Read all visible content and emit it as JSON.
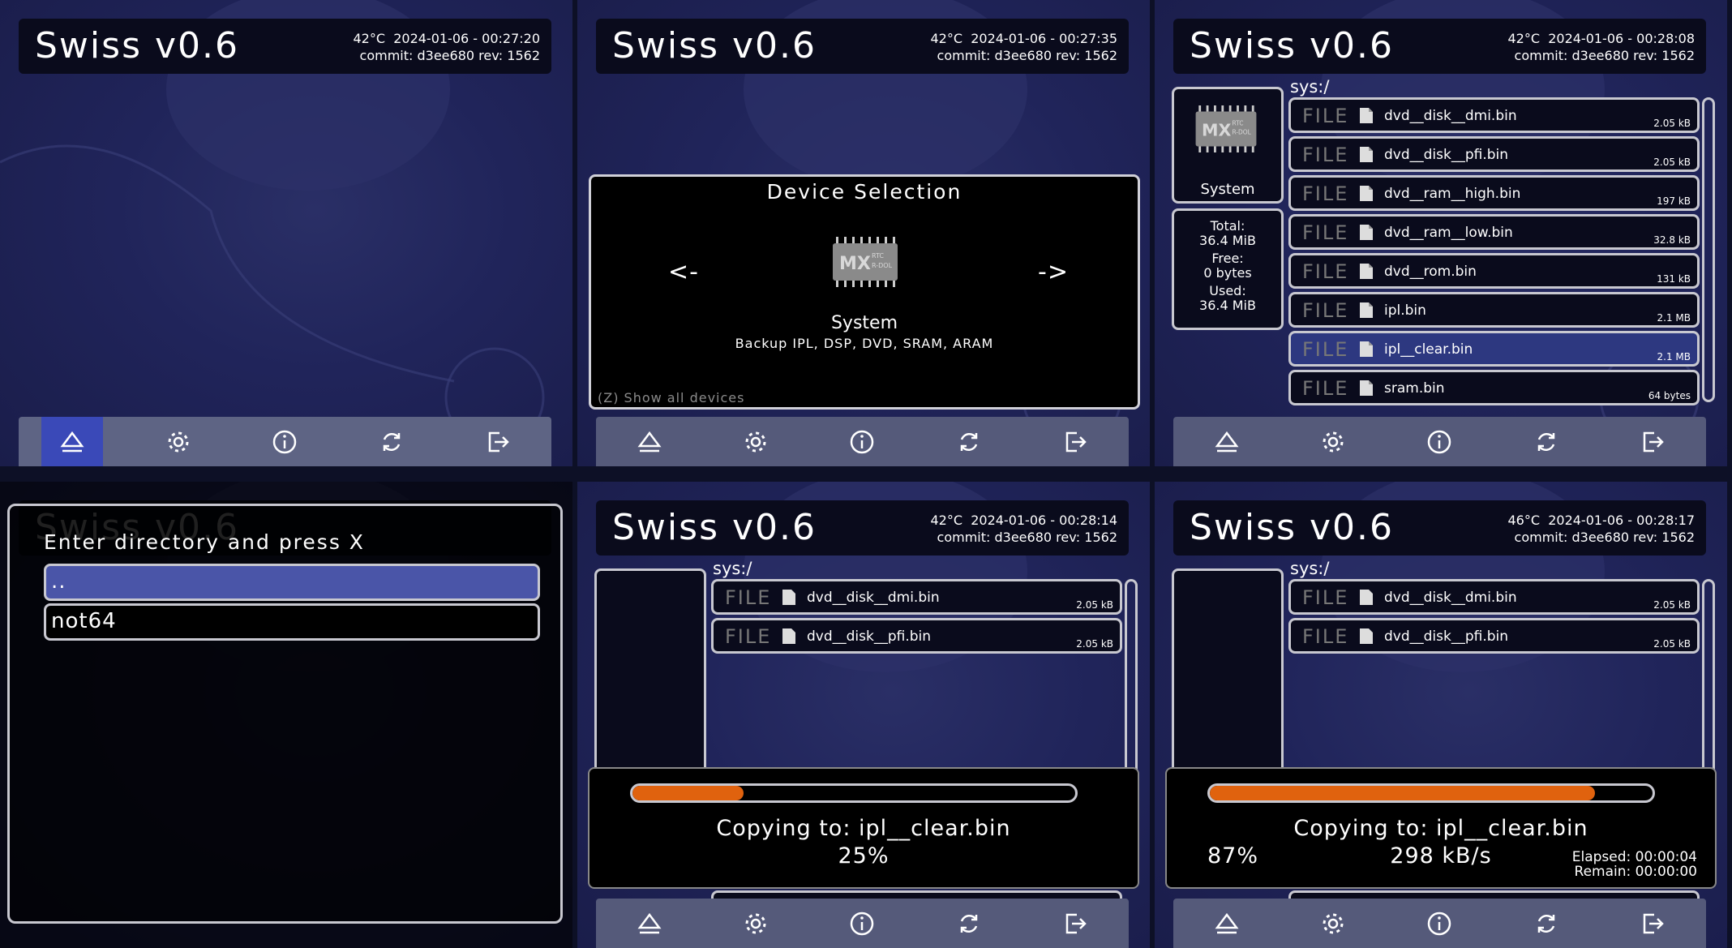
{
  "app": {
    "title": "Swiss v0.6"
  },
  "panels": [
    {
      "temp": "42°C",
      "datetime": "2024-01-06 - 00:27:20",
      "commit": "commit: d3ee680 rev: 1562"
    },
    {
      "temp": "42°C",
      "datetime": "2024-01-06 - 00:27:35",
      "commit": "commit: d3ee680 rev: 1562"
    },
    {
      "temp": "42°C",
      "datetime": "2024-01-06 - 00:28:08",
      "commit": "commit: d3ee680 rev: 1562"
    },
    {
      "temp": "",
      "datetime": "",
      "commit": ""
    },
    {
      "temp": "42°C",
      "datetime": "2024-01-06 - 00:28:14",
      "commit": "commit: d3ee680 rev: 1562"
    },
    {
      "temp": "46°C",
      "datetime": "2024-01-06 - 00:28:17",
      "commit": "commit: d3ee680 rev: 1562"
    }
  ],
  "toolbar": {
    "icons": [
      "eject-icon",
      "gear-icon",
      "info-icon",
      "refresh-icon",
      "exit-icon"
    ],
    "active_index": 0
  },
  "device_selection": {
    "title": "Device Selection",
    "prev": "<-",
    "next": "->",
    "device_name": "System",
    "device_desc": "Backup IPL, DSP, DVD, SRAM, ARAM",
    "hint": "(Z) Show all devices"
  },
  "device": {
    "label": "System",
    "chip_text_main": "MX",
    "chip_text_small": "RTC\nR-DOL",
    "total_label": "Total:",
    "total": "36.4 MiB",
    "free_label": "Free:",
    "free": "0 bytes",
    "used_label": "Used:",
    "used": "36.4 MiB"
  },
  "browser": {
    "path": "sys:/",
    "files": [
      {
        "type": "FILE",
        "name": "dvd__disk__dmi.bin",
        "size": "2.05 kB"
      },
      {
        "type": "FILE",
        "name": "dvd__disk__pfi.bin",
        "size": "2.05 kB"
      },
      {
        "type": "FILE",
        "name": "dvd__ram__high.bin",
        "size": "197 kB"
      },
      {
        "type": "FILE",
        "name": "dvd__ram__low.bin",
        "size": "32.8 kB"
      },
      {
        "type": "FILE",
        "name": "dvd__rom.bin",
        "size": "131 kB"
      },
      {
        "type": "FILE",
        "name": "ipl.bin",
        "size": "2.1 MB"
      },
      {
        "type": "FILE",
        "name": "ipl__clear.bin",
        "size": "2.1 MB"
      },
      {
        "type": "FILE",
        "name": "sram.bin",
        "size": "64 bytes"
      }
    ],
    "selected_index": 6
  },
  "dir_dialog": {
    "title": "Enter directory and press X",
    "options": [
      "..",
      "not64"
    ],
    "selected_index": 0
  },
  "copy_progress": [
    {
      "text": "Copying to: ipl__clear.bin",
      "percent": "25%",
      "fraction": 0.25,
      "rate": "",
      "elapsed": "",
      "remain": ""
    },
    {
      "text": "Copying to: ipl__clear.bin",
      "percent": "87%",
      "fraction": 0.87,
      "rate": "298 kB/s",
      "elapsed": "Elapsed: 00:00:04",
      "remain": "Remain: 00:00:00"
    }
  ],
  "colors": {
    "accent_orange": "#e0620e",
    "selection_blue": "#2d3880",
    "panel_bg": "#20245a"
  }
}
